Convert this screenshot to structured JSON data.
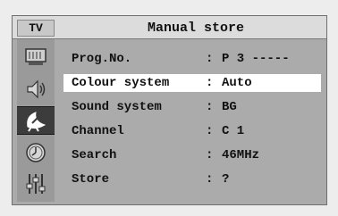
{
  "header": {
    "source_tab": "TV",
    "title": "Manual store"
  },
  "sidebar": {
    "icons": [
      {
        "name": "picture-icon",
        "active": false
      },
      {
        "name": "sound-icon",
        "active": false
      },
      {
        "name": "channel-antenna-icon",
        "active": true
      },
      {
        "name": "timer-clock-icon",
        "active": false
      },
      {
        "name": "setup-sliders-icon",
        "active": false
      }
    ]
  },
  "menu": {
    "separator": ":",
    "rows": [
      {
        "label": "Prog.No.",
        "value": "P 3 -----",
        "highlighted": false
      },
      {
        "label": "Colour system",
        "value": "Auto",
        "highlighted": true
      },
      {
        "label": "Sound system",
        "value": "BG",
        "highlighted": false
      },
      {
        "label": "Channel",
        "value": "C 1",
        "highlighted": false
      },
      {
        "label": "Search",
        "value": "46MHz",
        "highlighted": false
      },
      {
        "label": "Store",
        "value": "?",
        "highlighted": false
      }
    ]
  },
  "colors": {
    "panel": "#ababab",
    "header": "#dcdcdc",
    "highlight": "#ffffff",
    "active_icon_bg": "#3c3c3c"
  }
}
